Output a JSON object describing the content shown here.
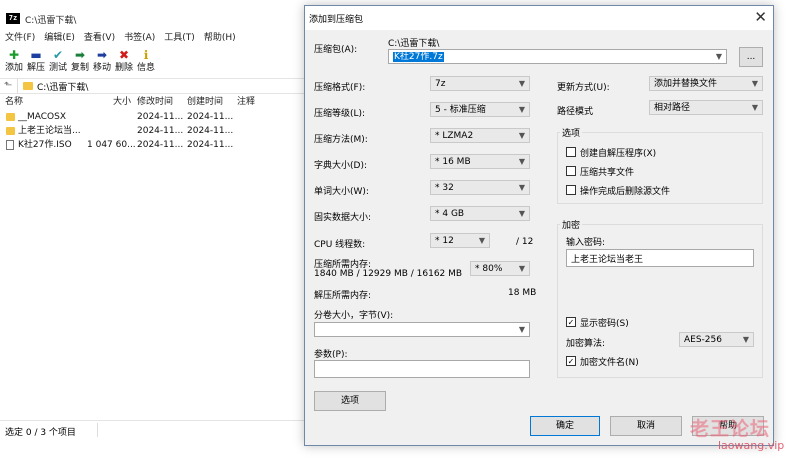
{
  "main": {
    "title": "C:\\迅雷下载\\",
    "menu": [
      "文件(F)",
      "编辑(E)",
      "查看(V)",
      "书签(A)",
      "工具(T)",
      "帮助(H)"
    ],
    "toolbar": [
      {
        "label": "添加",
        "icon": "plus-icon",
        "color": "#1a9c2e"
      },
      {
        "label": "解压",
        "icon": "minus-icon",
        "color": "#1c3fa0"
      },
      {
        "label": "测试",
        "icon": "check-icon",
        "color": "#2a9aa8"
      },
      {
        "label": "复制",
        "icon": "arrow-right-green-icon",
        "color": "#1a7f3a"
      },
      {
        "label": "移动",
        "icon": "arrow-right-blue-icon",
        "color": "#1c3fa0"
      },
      {
        "label": "删除",
        "icon": "delete-x-icon",
        "color": "#d21b1b"
      },
      {
        "label": "信息",
        "icon": "info-icon",
        "color": "#c9a000"
      }
    ],
    "address": "C:\\迅雷下载\\",
    "columns": {
      "name": "名称",
      "size": "大小",
      "modified": "修改时间",
      "created": "创建时间",
      "comment": "注释"
    },
    "files": [
      {
        "name": "__MACOSX",
        "size": "",
        "modified": "2024-11...",
        "created": "2024-11...",
        "type": "folder"
      },
      {
        "name": "上老王论坛当...",
        "size": "",
        "modified": "2024-11...",
        "created": "2024-11...",
        "type": "folder"
      },
      {
        "name": "K社27作.ISO",
        "size": "1 047 60...",
        "modified": "2024-11...",
        "created": "2024-11...",
        "type": "file"
      }
    ],
    "status": "选定 0 / 3 个项目"
  },
  "dialog": {
    "title": "添加到压缩包",
    "close": "✕",
    "archive_label": "压缩包(A):",
    "archive_path": "C:\\迅雷下载\\",
    "archive_name": "K社27作.7z",
    "browse_label": "...",
    "format_label": "压缩格式(F):",
    "format_value": "7z",
    "level_label": "压缩等级(L):",
    "level_value": "5 - 标准压缩",
    "method_label": "压缩方法(M):",
    "method_value": "* LZMA2",
    "dict_label": "字典大小(D):",
    "dict_value": "* 16 MB",
    "word_label": "单词大小(W):",
    "word_value": "* 32",
    "solid_label": "固实数据大小:",
    "solid_value": "* 4 GB",
    "cpu_label": "CPU 线程数:",
    "cpu_value": "* 12",
    "cpu_total": "/ 12",
    "mem_label": "压缩所需内存:",
    "mem_detail": "1840 MB / 12929 MB / 16162 MB",
    "mem_value": "* 80%",
    "decomp_label": "解压所需内存:",
    "decomp_value": "18 MB",
    "split_label": "分卷大小，字节(V):",
    "split_value": "",
    "params_label": "参数(P):",
    "params_value": "",
    "options_button": "选项",
    "update_label": "更新方式(U):",
    "update_value": "添加并替换文件",
    "path_label": "路径模式",
    "path_value": "相对路径",
    "options_group": "选项",
    "opt_sfx": "创建自解压程序(X)",
    "opt_shared": "压缩共享文件",
    "opt_delete": "操作完成后删除源文件",
    "encrypt_group": "加密",
    "password_label": "输入密码:",
    "password_value": "上老王论坛当老王",
    "show_password": "显示密码(S)",
    "enc_method_label": "加密算法:",
    "enc_method_value": "AES-256",
    "encrypt_names": "加密文件名(N)",
    "ok": "确定",
    "cancel": "取消",
    "help": "帮助"
  },
  "watermark": {
    "main": "老王论坛",
    "sub": "laowang.vip"
  }
}
